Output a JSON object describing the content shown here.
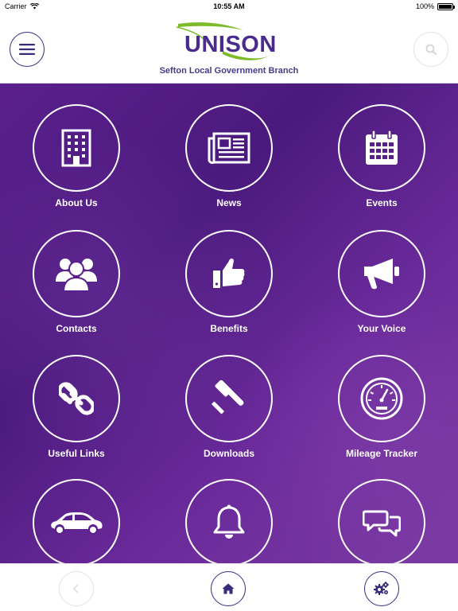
{
  "status_bar": {
    "carrier": "Carrier",
    "time": "10:55 AM",
    "battery": "100%"
  },
  "header": {
    "logo_text": "UNISON",
    "branch_name": "Sefton Local Government Branch",
    "menu_icon": "hamburger-menu-icon",
    "search_icon": "search-icon"
  },
  "tiles": [
    {
      "label": "About Us",
      "icon": "building-icon"
    },
    {
      "label": "News",
      "icon": "newspaper-icon"
    },
    {
      "label": "Events",
      "icon": "calendar-icon"
    },
    {
      "label": "Contacts",
      "icon": "people-icon"
    },
    {
      "label": "Benefits",
      "icon": "thumbs-up-icon"
    },
    {
      "label": "Your Voice",
      "icon": "megaphone-icon"
    },
    {
      "label": "Useful Links",
      "icon": "chain-link-icon"
    },
    {
      "label": "Downloads",
      "icon": "gavel-icon"
    },
    {
      "label": "Mileage Tracker",
      "icon": "speedometer-icon"
    },
    {
      "label": "",
      "icon": "car-icon"
    },
    {
      "label": "",
      "icon": "bell-icon"
    },
    {
      "label": "",
      "icon": "chat-bubbles-icon"
    }
  ],
  "bottom_nav": {
    "back_icon": "chevron-left-icon",
    "home_icon": "home-icon",
    "settings_icon": "gears-icon"
  },
  "colors": {
    "brand_purple": "#4a2a8c",
    "background_purple": "#5a1f8c",
    "logo_green": "#7dbb2a"
  }
}
